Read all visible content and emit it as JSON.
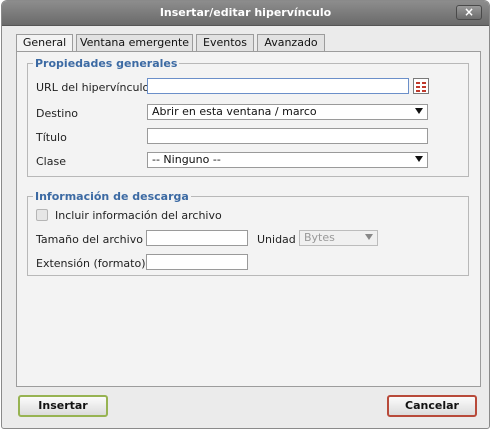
{
  "dialog": {
    "title": "Insertar/editar hipervínculo",
    "close_label": "×"
  },
  "tabs": [
    {
      "label": "General",
      "active": true
    },
    {
      "label": "Ventana emergente",
      "active": false
    },
    {
      "label": "Eventos",
      "active": false
    },
    {
      "label": "Avanzado",
      "active": false
    }
  ],
  "general": {
    "legend": "Propiedades generales",
    "url_label": "URL del hipervínculo",
    "url_value": "",
    "target_label": "Destino",
    "target_value": "Abrir en esta ventana / marco",
    "title_label": "Título",
    "title_value": "",
    "class_label": "Clase",
    "class_value": "-- Ninguno --"
  },
  "download": {
    "legend": "Información de descarga",
    "include_label": "Incluir información del archivo",
    "include_checked": false,
    "size_label": "Tamaño del archivo",
    "size_value": "",
    "unit_label": "Unidad",
    "unit_value": "Bytes",
    "ext_label": "Extensión (formato)",
    "ext_value": ""
  },
  "buttons": {
    "insert": "Insertar",
    "cancel": "Cancelar"
  },
  "colors": {
    "legend": "#3c6aa3",
    "insert_border": "#97b352",
    "cancel_border": "#b84a3a",
    "titlebar": "#7a7a7a"
  }
}
